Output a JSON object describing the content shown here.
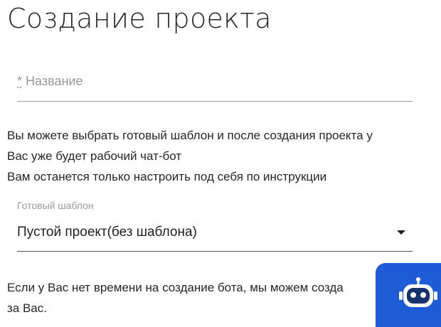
{
  "page": {
    "title": "Создание проекта"
  },
  "name_field": {
    "required_mark": "*",
    "placeholder": "Название",
    "value": ""
  },
  "info": {
    "lines": [
      "Вы можете выбрать готовый шаблон и после создания проекта у",
      "Вас уже будет рабочий чат-бот",
      "Вам останется только настроить под себя по инструкции"
    ]
  },
  "template": {
    "label": "Готовый шаблон",
    "selected": "Пустой проект(без шаблона)"
  },
  "help": {
    "lines": [
      "Если у Вас нет времени на создание бота, мы можем созда",
      "за Вас."
    ]
  },
  "chat_widget": {
    "icon": "robot-icon",
    "background": "#1e5bd6"
  }
}
